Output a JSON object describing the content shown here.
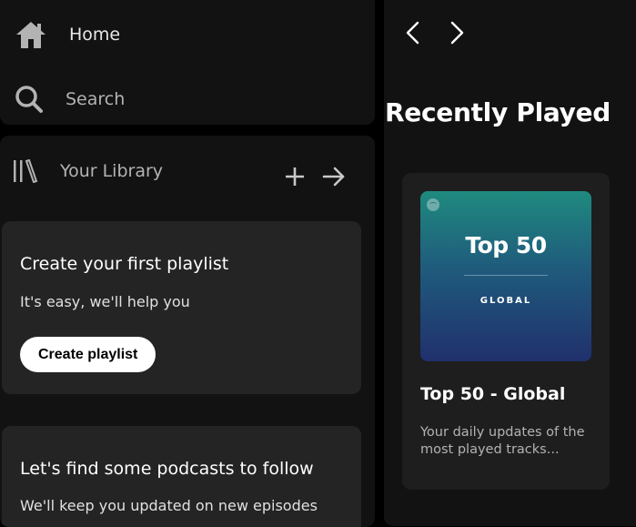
{
  "nav": {
    "home_label": "Home",
    "search_label": "Search"
  },
  "library": {
    "title": "Your Library",
    "playlist_card": {
      "title": "Create your first playlist",
      "subtitle": "It's easy, we'll help you",
      "button_label": "Create playlist"
    },
    "podcast_card": {
      "title": "Let's find some podcasts to follow",
      "subtitle": "We'll keep you updated on new episodes"
    }
  },
  "main": {
    "section_title": "Recently Played",
    "cards": [
      {
        "cover_title": "Top 50",
        "cover_subtitle": "GLOBAL",
        "title": "Top 50 - Global",
        "description": "Your daily updates of the most played tracks..."
      }
    ]
  },
  "colors": {
    "background": "#000000",
    "panel": "#121212",
    "card": "#242424",
    "muted_text": "#b3b3b3",
    "cover_top": "#1f8a7f",
    "cover_bottom": "#20306d"
  },
  "icons": [
    "home-icon",
    "search-icon",
    "library-icon",
    "plus-icon",
    "arrow-right-icon",
    "chevron-left-icon",
    "chevron-right-icon",
    "spotify-logo-icon"
  ]
}
